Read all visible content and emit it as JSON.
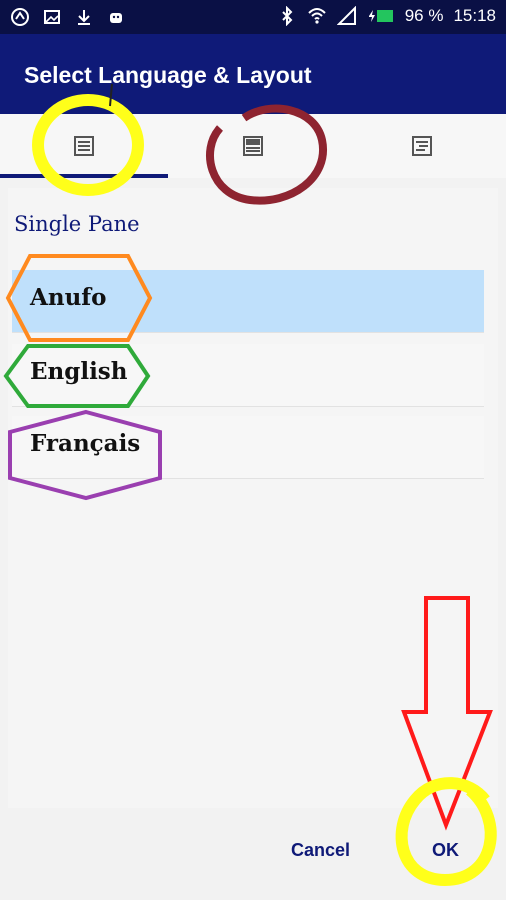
{
  "status_bar": {
    "battery": "96 %",
    "time": "15:18",
    "left_icons": [
      "app-logo-icon",
      "image-icon",
      "download-icon",
      "android-icon"
    ],
    "right_icons": [
      "bluetooth-icon",
      "wifi-icon",
      "signal-icon",
      "battery-icon"
    ]
  },
  "app_bar": {
    "title": "Select Language & Layout"
  },
  "tabs": [
    {
      "icon": "single-pane-icon",
      "selected": true
    },
    {
      "icon": "two-pane-icon",
      "selected": false
    },
    {
      "icon": "interlinear-icon",
      "selected": false
    }
  ],
  "section": {
    "title": "Single Pane"
  },
  "languages": [
    {
      "label": "Anufo",
      "selected": true
    },
    {
      "label": "English",
      "selected": false
    },
    {
      "label": "Français",
      "selected": false
    }
  ],
  "buttons": {
    "cancel": "Cancel",
    "ok": "OK"
  },
  "colors": {
    "app_bar": "#0f1a78",
    "status_bar": "#0a1045",
    "selected_row": "#bfe0fb"
  }
}
